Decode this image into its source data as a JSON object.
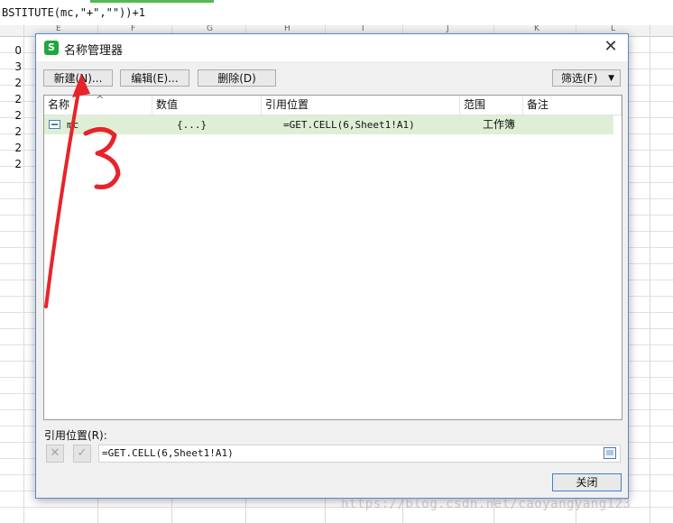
{
  "formula_bar": {
    "text": "BSTITUTE(mc,\"+\",\"\"))+1"
  },
  "sheet": {
    "column_letters": [
      "E",
      "F",
      "G",
      "H",
      "I",
      "J",
      "K",
      "L"
    ],
    "row_values": [
      "0",
      "3",
      "2",
      "2",
      "2",
      "2",
      "2",
      "2"
    ]
  },
  "dialog": {
    "title": "名称管理器",
    "app_icon_letter": "S",
    "close_glyph": "✕",
    "toolbar": {
      "new_label": "新建(N)...",
      "edit_label": "编辑(E)...",
      "delete_label": "删除(D)",
      "filter_label": "筛选(F)",
      "filter_arrow": "▼"
    },
    "columns": [
      "名称",
      "数值",
      "引用位置",
      "范围",
      "备注"
    ],
    "sort_caret": "^",
    "rows": [
      {
        "name": "mc",
        "value": "{...}",
        "ref": "=GET.CELL(6,Sheet1!A1)",
        "scope": "工作簿",
        "note": ""
      }
    ],
    "ref_label": "引用位置(R):",
    "ref_cancel": "✕",
    "ref_ok": "✓",
    "ref_value": "=GET.CELL(6,Sheet1!A1)",
    "close_label": "关闭"
  },
  "annotation": {
    "text": "3",
    "color": "#e8232a"
  },
  "watermark": "https://blog.csdn.net/caoyangyang123",
  "colors": {
    "selected_row": "#dfefd6",
    "accent": "#3c7fd3",
    "app_icon": "#1fa83f"
  }
}
